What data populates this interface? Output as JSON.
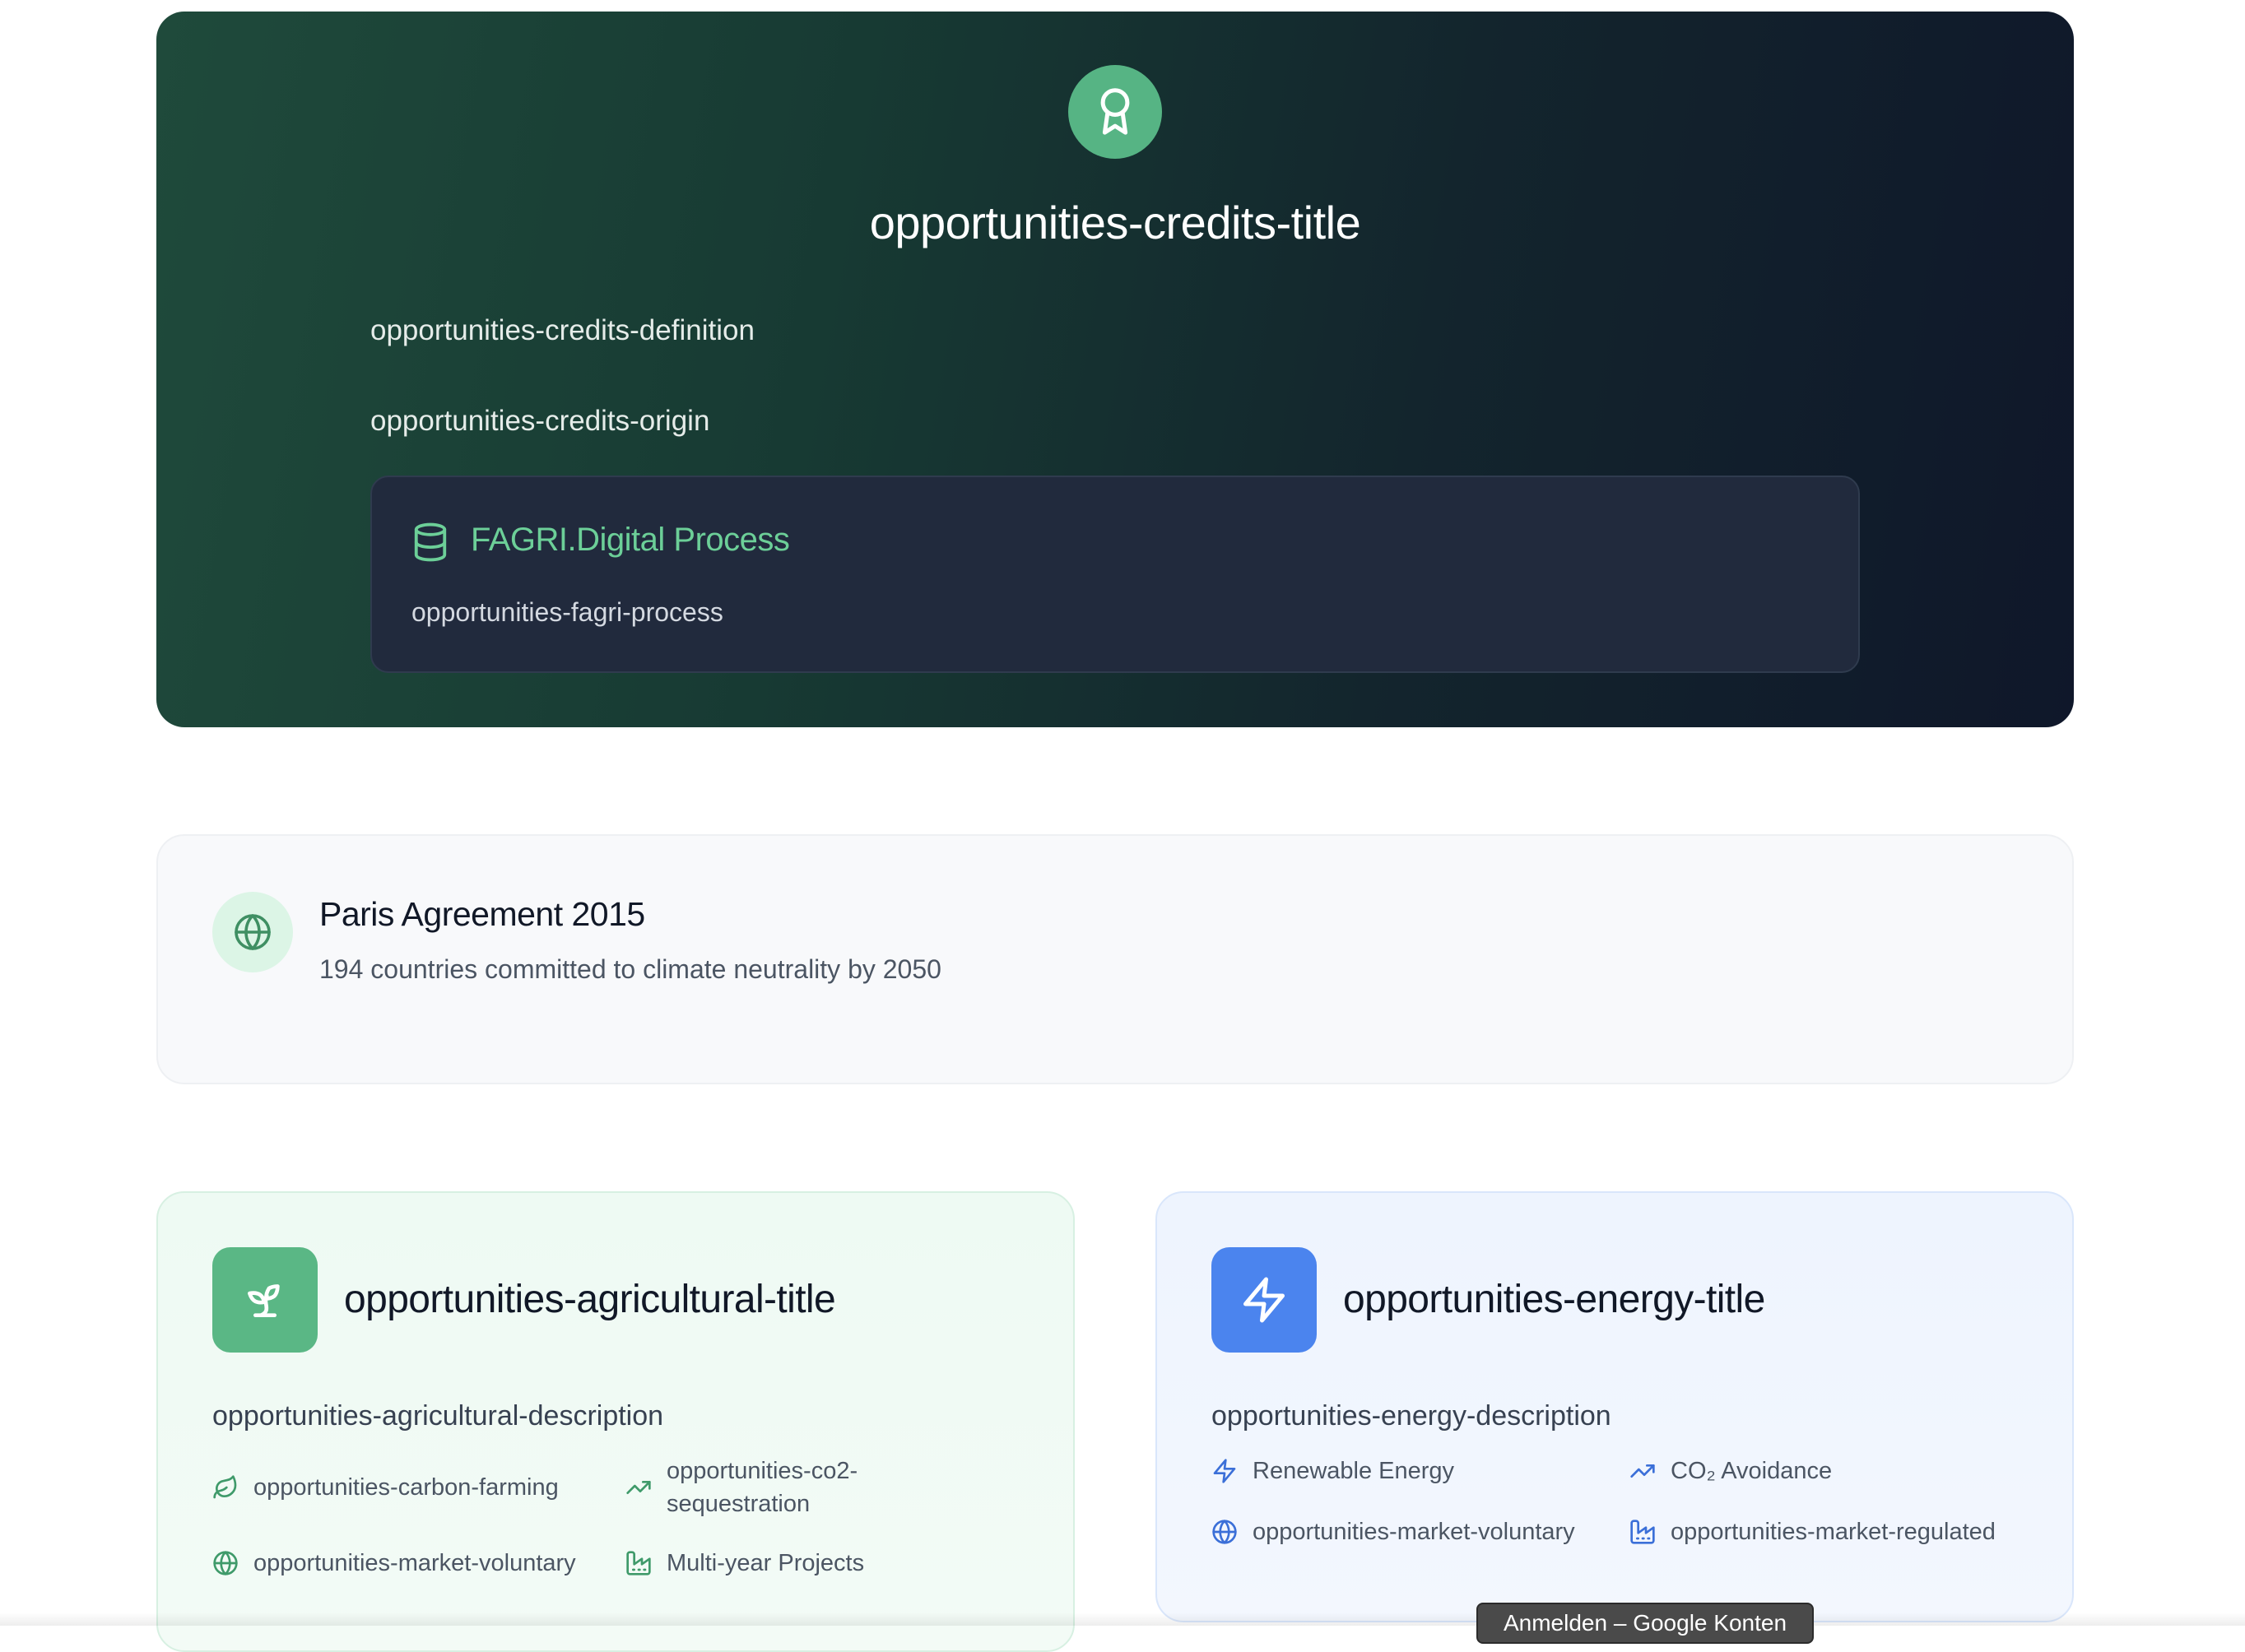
{
  "hero": {
    "title": "opportunities-credits-title",
    "definition": "opportunities-credits-definition",
    "origin": "opportunities-credits-origin",
    "process": {
      "title": "FAGRI.Digital Process",
      "text": "opportunities-fagri-process"
    },
    "badge_icon": "award-icon",
    "accent_color": "#56b484"
  },
  "paris": {
    "title": "Paris Agreement 2015",
    "subtitle": "194 countries committed to climate neutrality by 2050",
    "icon": "globe-icon"
  },
  "cards": {
    "agricultural": {
      "title": "opportunities-agricultural-title",
      "description": "opportunities-agricultural-description",
      "icon": "sprout-icon",
      "color": "#5ab785",
      "features": [
        {
          "label": "opportunities-carbon-farming",
          "icon": "leaf-icon"
        },
        {
          "label": "opportunities-co2-sequestration",
          "line1": "opportunities-co2-",
          "line2": "sequestration",
          "icon": "trending-up-icon"
        },
        {
          "label": "opportunities-market-voluntary",
          "icon": "globe-icon"
        },
        {
          "label": "Multi-year Projects",
          "icon": "factory-icon"
        }
      ]
    },
    "energy": {
      "title": "opportunities-energy-title",
      "description": "opportunities-energy-description",
      "icon": "zap-icon",
      "color": "#4b84ee",
      "features": [
        {
          "label": "Renewable Energy",
          "icon": "zap-icon"
        },
        {
          "label": "CO₂ Avoidance",
          "icon": "trending-up-icon"
        },
        {
          "label": "opportunities-market-voluntary",
          "icon": "globe-icon"
        },
        {
          "label": "opportunities-market-regulated",
          "icon": "factory-icon"
        }
      ]
    }
  },
  "tooltip": {
    "text": "Anmelden – Google Konten"
  }
}
